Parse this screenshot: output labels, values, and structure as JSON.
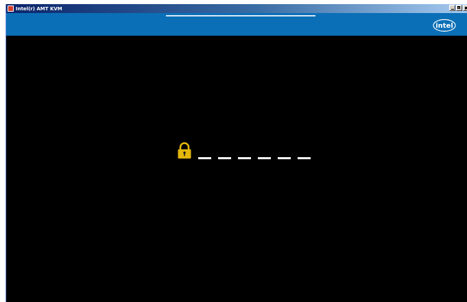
{
  "window": {
    "title": "Intel(r) AMT KVM",
    "controls": [
      "minimize",
      "maximize",
      "close"
    ]
  },
  "toolbar": {
    "background": "#0b6fb7",
    "logo_text": "intel",
    "logo_color": "#ffffff"
  },
  "screen": {
    "background": "#000000",
    "lock_icon": "padlock-icon",
    "lock_color": "#e3b70b",
    "pin_slots": 6,
    "pin_dash_color": "#ffffff"
  }
}
